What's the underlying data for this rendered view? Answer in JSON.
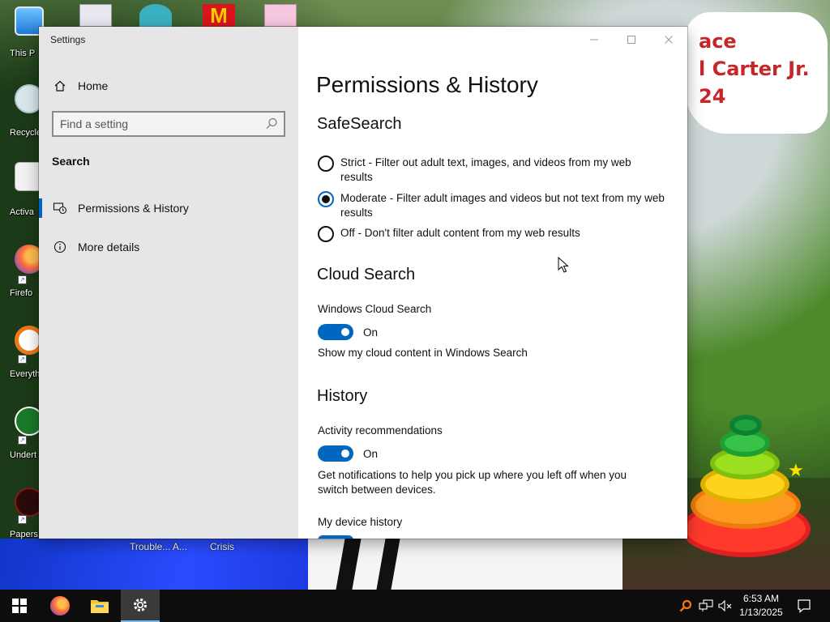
{
  "desktop": {
    "icons": [
      {
        "label": "This P",
        "name": "desktop-icon-this-pc"
      },
      {
        "label": "Recycle",
        "name": "desktop-icon-recycle-bin"
      },
      {
        "label": "Activa",
        "name": "desktop-icon-activa"
      },
      {
        "label": "Firefo",
        "name": "desktop-icon-firefox"
      },
      {
        "label": "Everyth",
        "name": "desktop-icon-everything"
      },
      {
        "label": "Undert",
        "name": "desktop-icon-undertale"
      },
      {
        "label": "Papers, P",
        "name": "desktop-icon-papers-please"
      }
    ],
    "bottom_labels": [
      "Trouble... A...",
      "Crisis"
    ],
    "banner_text": "ace\nl Carter Jr.\n24"
  },
  "window": {
    "title": "Settings",
    "controls": {
      "minimize": "—",
      "maximize": "☐",
      "close": "✕"
    }
  },
  "sidebar": {
    "home_label": "Home",
    "search_placeholder": "Find a setting",
    "section_title": "Search",
    "items": [
      {
        "label": "Permissions & History",
        "icon": "shield-history-icon",
        "selected": true
      },
      {
        "label": "More details",
        "icon": "info-icon",
        "selected": false
      }
    ]
  },
  "content": {
    "title": "Permissions & History",
    "safesearch": {
      "heading": "SafeSearch",
      "options": [
        {
          "label": "Strict - Filter out adult text, images, and videos from my web results",
          "checked": false
        },
        {
          "label": "Moderate - Filter adult images and videos but not text from my web results",
          "checked": true
        },
        {
          "label": "Off - Don't filter adult content from my web results",
          "checked": false
        }
      ]
    },
    "cloud": {
      "heading": "Cloud Search",
      "setting_label": "Windows Cloud Search",
      "state": "On",
      "description": "Show my cloud content in Windows Search"
    },
    "history": {
      "heading": "History",
      "setting_label": "Activity recommendations",
      "state": "On",
      "description": "Get notifications to help you pick up where you left off when you switch between devices.",
      "device_history_label": "My device history"
    }
  },
  "taskbar": {
    "clock_time": "6:53 AM",
    "clock_date": "1/13/2025",
    "accent": "#0067c0"
  }
}
